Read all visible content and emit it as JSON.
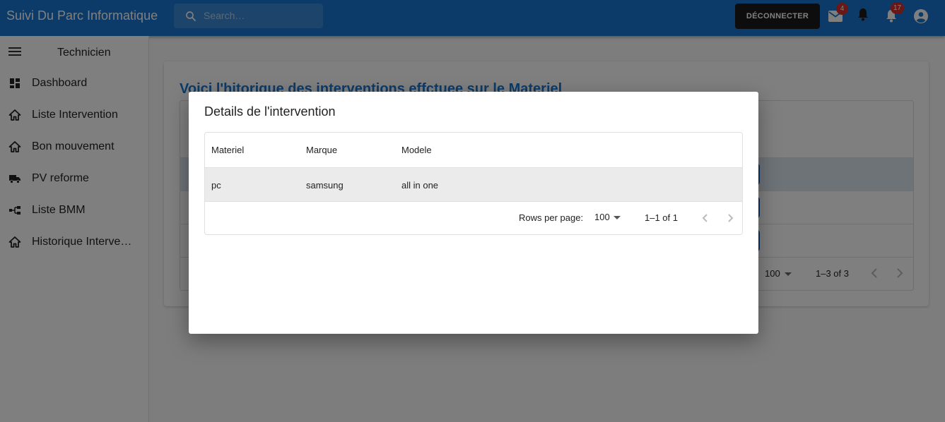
{
  "header": {
    "app_title": "Suivi Du Parc Informatique",
    "search_placeholder": "Search…",
    "logout_label": "DÉCONNECTER",
    "mail_badge": "4",
    "notifications_badge": "17"
  },
  "sidebar": {
    "role": "Technicien",
    "items": [
      {
        "label": "Dashboard",
        "icon": "dashboard-icon"
      },
      {
        "label": "Liste Intervention",
        "icon": "home-icon"
      },
      {
        "label": "Bon mouvement",
        "icon": "home-icon"
      },
      {
        "label": "PV reforme",
        "icon": "truck-icon"
      },
      {
        "label": "Liste BMM",
        "icon": "tree-icon"
      },
      {
        "label": "Historique Interventions",
        "icon": "home-icon"
      }
    ]
  },
  "main": {
    "title": "Voici l'hitorique des interventions effctuee sur le Materiel",
    "rows_per_page": "100",
    "pagination": "1–3 of 3"
  },
  "modal": {
    "title": "Details de l'intervention",
    "columns": [
      "Materiel",
      "Marque",
      "Modele"
    ],
    "rows": [
      [
        "pc",
        "samsung",
        "all in one"
      ]
    ],
    "rows_per_page_label": "Rows per page:",
    "rows_per_page": "100",
    "pagination": "1–1 of 1"
  },
  "colors": {
    "appbar": "#1976d2",
    "badge": "#d32f2f",
    "title_accent": "#1976d2"
  }
}
